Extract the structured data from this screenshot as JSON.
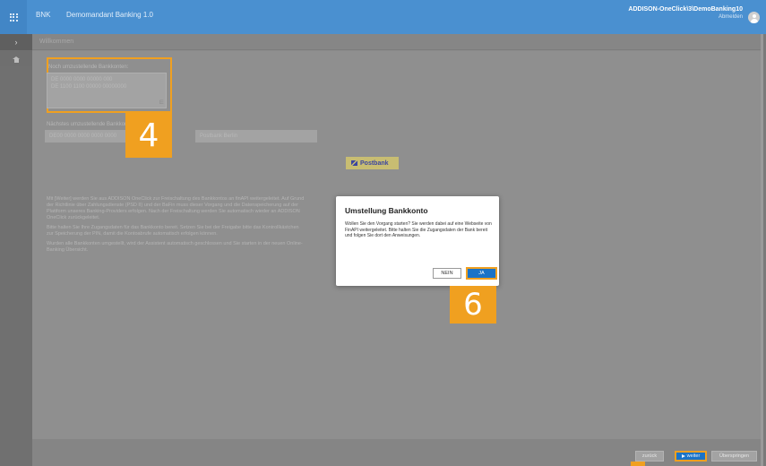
{
  "topbar": {
    "brand": "BNK",
    "app_title": "Demomandant Banking 1.0",
    "user_name": "ADDISON-OneClick\\3\\DemoBanking10",
    "logout": "Abmelden"
  },
  "nav": {
    "expand_icon": "chevron-right-icon",
    "home_icon": "home-icon",
    "apps_icon": "apps-grid-icon"
  },
  "breadcrumb": "Willkommen",
  "form": {
    "accounts_label": "Noch umzustellende Bankkonten:",
    "accounts_lines": [
      "DE 0000 0000 00000 000",
      "DE 1100 1100 00000 00000000"
    ],
    "next_account_label": "Nächstes umzustellende Bankkonto:",
    "next_account_value": "DE00 0000 0000 0000 0000",
    "bank_name": "Postbank Berlin",
    "bank_logo_text": "Postbank"
  },
  "markers": {
    "step_a": "4",
    "step_b": "6",
    "color": "#f0a020"
  },
  "info_paragraphs": [
    "Mit [Weiter] werden Sie aus ADDISON OneClick zur Freischaltung des Bankkontos an finAPI weitergeleitet. Auf Grund der Richtlinie über Zahlungsdienste (PSD II) und der BaFin muss dieser Vorgang und die Datenspeicherung auf der Plattform unseres Banking-Providers erfolgen. Nach der Freischaltung werden Sie automatisch wieder an ADDISON OneClick zurückgeleitet.",
    "Bitte halten Sie Ihre Zugangsdaten für das Bankkonto bereit. Setzen Sie bei der Freigabe bitte das Kontrollkästchen zur Speicherung der PIN, damit die Kontoabrufe automatisch erfolgen können.",
    "Wurden alle Bankkonten umgestellt, wird der Assistent automatisch geschlossen und Sie starten in der neuen Online-Banking Übersicht."
  ],
  "modal": {
    "title": "Umstellung Bankkonto",
    "text": "Wollen Sie den Vorgang starten? Sie werden dabei auf eine Webseite von FinAPI weitergeleitet. Bitte halten Sie die Zugangsdaten der Bank bereit und folgen Sie dort den Anweisungen.",
    "no_label": "NEIN",
    "yes_label": "JA"
  },
  "footer": {
    "back_label": "zurück",
    "next_label": "weiter",
    "skip_label": "Überspringen"
  },
  "colors": {
    "accent_blue": "#1a73c7",
    "topbar_blue": "#4a90d0",
    "highlight_orange": "#f0a020"
  }
}
